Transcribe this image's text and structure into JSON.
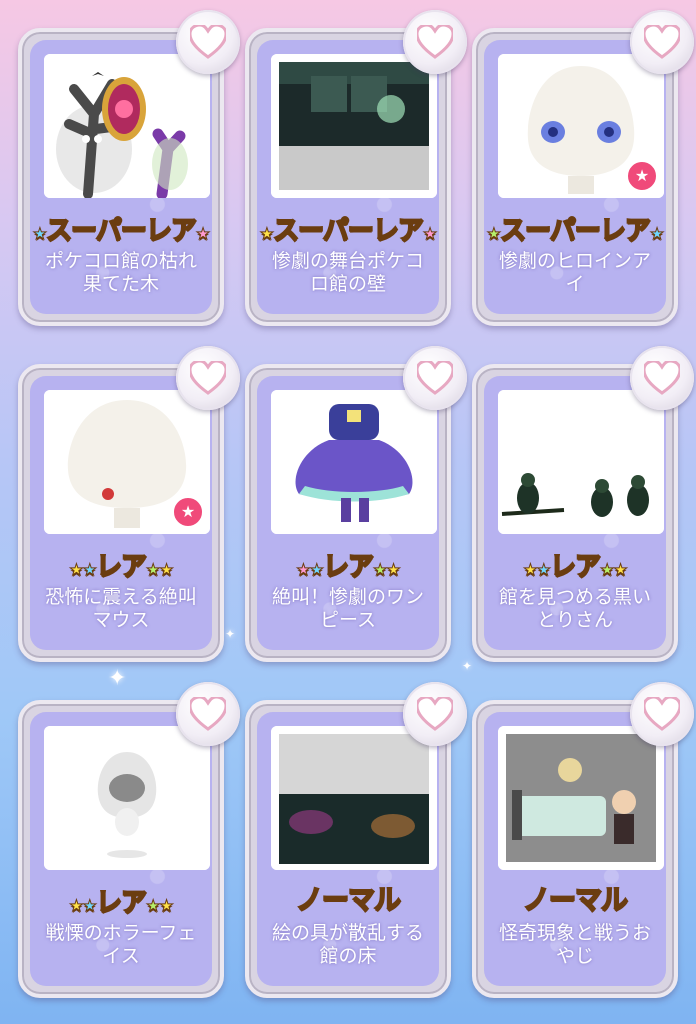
{
  "items": [
    {
      "rarity": "スーパーレア",
      "name": "ポケコロ館の枯れ果てた木",
      "tier": "super"
    },
    {
      "rarity": "スーパーレア",
      "name": "惨劇の舞台ポケコロ館の壁",
      "tier": "super"
    },
    {
      "rarity": "スーパーレア",
      "name": "惨劇のヒロインアイ",
      "tier": "super"
    },
    {
      "rarity": "レア",
      "name": "恐怖に震える絶叫マウス",
      "tier": "rare"
    },
    {
      "rarity": "レア",
      "name": "絶叫！惨劇のワンピース",
      "tier": "rare"
    },
    {
      "rarity": "レア",
      "name": "館を見つめる黒いとりさん",
      "tier": "rare"
    },
    {
      "rarity": "レア",
      "name": "戦慄のホラーフェイス",
      "tier": "rare"
    },
    {
      "rarity": "ノーマル",
      "name": "絵の具が散乱する館の床",
      "tier": "normal"
    },
    {
      "rarity": "ノーマル",
      "name": "怪奇現象と戦うおやじ",
      "tier": "normal"
    }
  ],
  "icons": {
    "favorite": "heart-icon",
    "new_badge": "star-badge-icon"
  },
  "colors": {
    "card_bg": "#b7b2f0",
    "rarity_text": "#f7d63b",
    "badge": "#f04a7a"
  }
}
